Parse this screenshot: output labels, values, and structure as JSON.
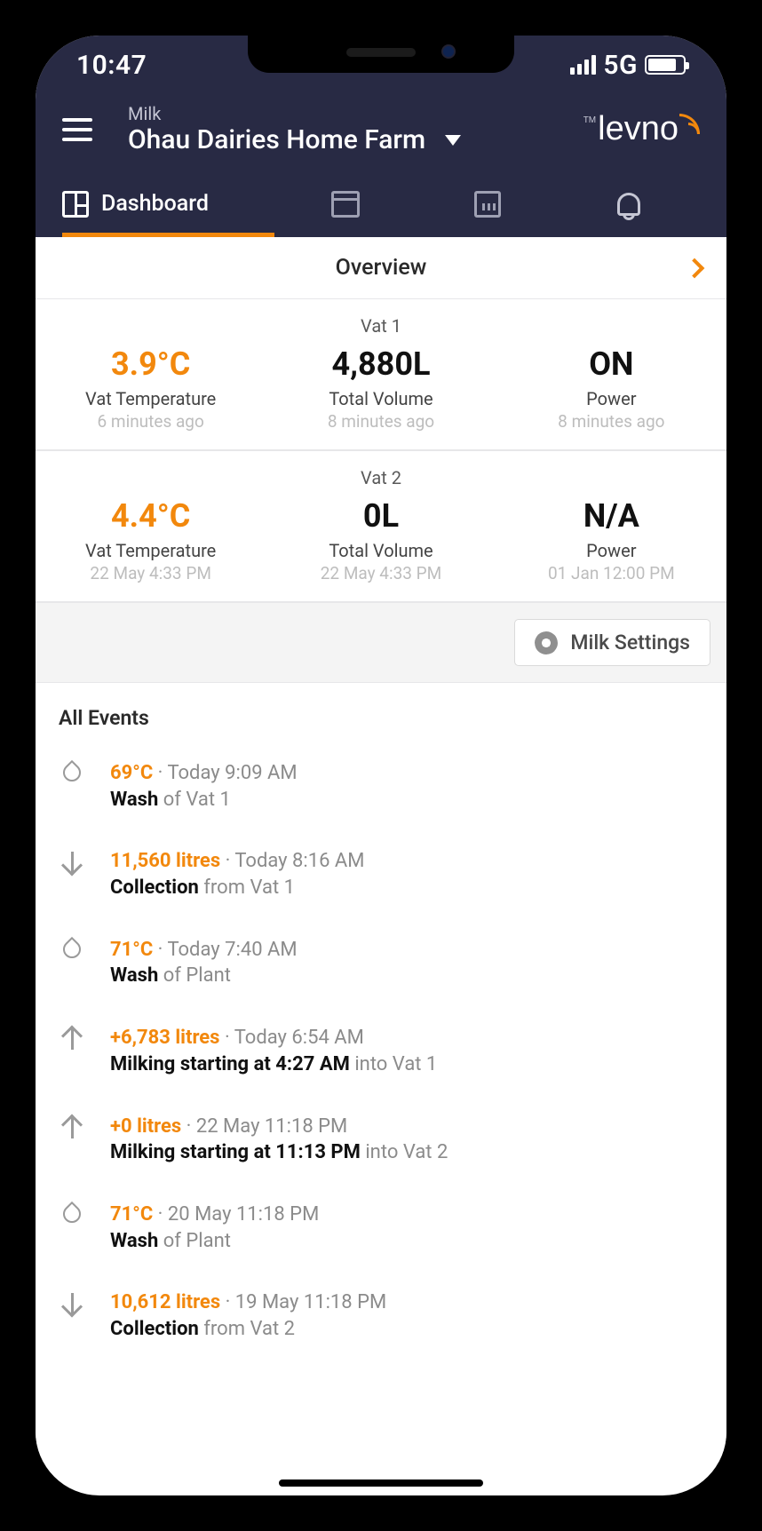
{
  "status": {
    "time": "10:47",
    "network": "5G"
  },
  "brand": {
    "name": "levno"
  },
  "header": {
    "category": "Milk",
    "farm": "Ohau Dairies Home Farm"
  },
  "tabs": {
    "dashboard": "Dashboard"
  },
  "overview": {
    "title": "Overview"
  },
  "vats": [
    {
      "name": "Vat 1",
      "temp": {
        "value": "3.9°C",
        "label": "Vat Temperature",
        "ago": "6 minutes ago"
      },
      "volume": {
        "value": "4,880L",
        "label": "Total Volume",
        "ago": "8 minutes ago"
      },
      "power": {
        "value": "ON",
        "label": "Power",
        "ago": "8 minutes ago"
      }
    },
    {
      "name": "Vat 2",
      "temp": {
        "value": "4.4°C",
        "label": "Vat Temperature",
        "ago": "22 May 4:33 PM"
      },
      "volume": {
        "value": "0L",
        "label": "Total Volume",
        "ago": "22 May 4:33 PM"
      },
      "power": {
        "value": "N/A",
        "label": "Power",
        "ago": "01 Jan 12:00 PM"
      }
    }
  ],
  "settings_btn": "Milk Settings",
  "events_title": "All Events",
  "events": [
    {
      "icon": "drop",
      "highlight": "69°C",
      "when": "Today 9:09 AM",
      "bold": "Wash",
      "rest": " of Vat 1"
    },
    {
      "icon": "down",
      "highlight": "11,560 litres",
      "when": "Today 8:16 AM",
      "bold": "Collection",
      "rest": " from Vat 1"
    },
    {
      "icon": "drop",
      "highlight": "71°C",
      "when": "Today 7:40 AM",
      "bold": "Wash",
      "rest": " of Plant"
    },
    {
      "icon": "up",
      "highlight": "+6,783 litres",
      "when": "Today 6:54 AM",
      "bold": "Milking starting at 4:27 AM",
      "rest": " into Vat 1"
    },
    {
      "icon": "up",
      "highlight": "+0 litres",
      "when": "22 May 11:18 PM",
      "bold": "Milking starting at 11:13 PM",
      "rest": " into Vat 2"
    },
    {
      "icon": "drop",
      "highlight": "71°C",
      "when": "20 May 11:18 PM",
      "bold": "Wash",
      "rest": " of Plant"
    },
    {
      "icon": "down",
      "highlight": "10,612 litres",
      "when": "19 May 11:18 PM",
      "bold": "Collection",
      "rest": " from Vat 2"
    }
  ]
}
